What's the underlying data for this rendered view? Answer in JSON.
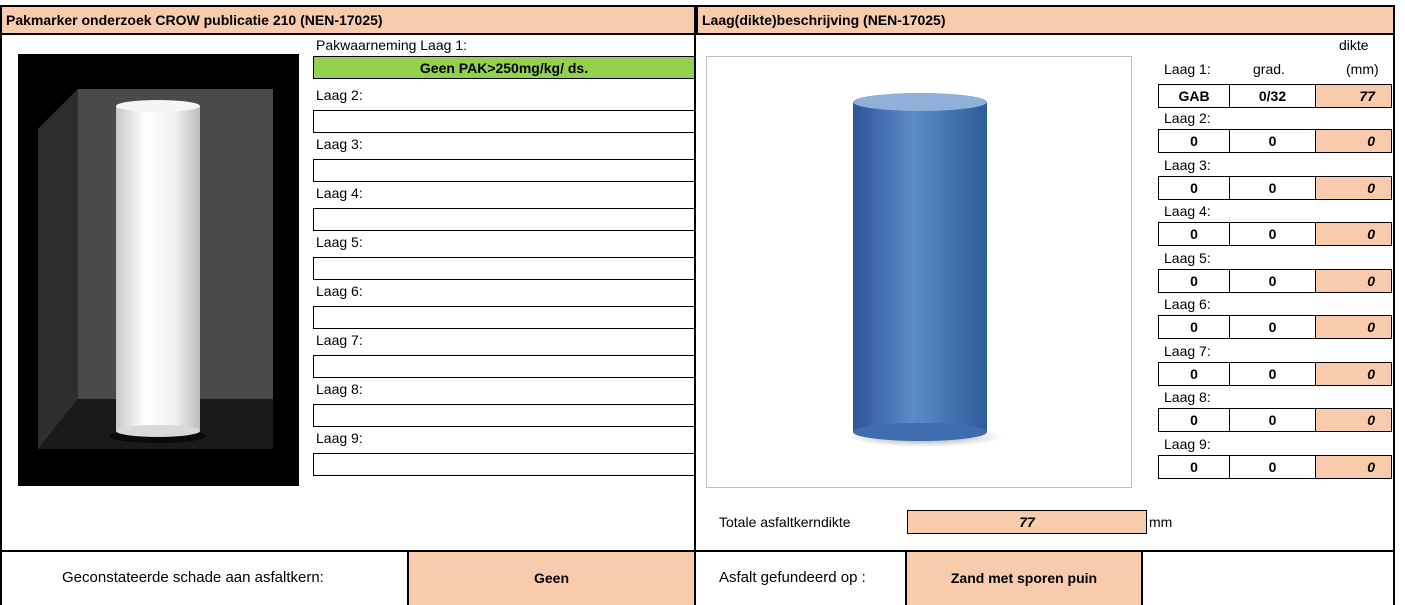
{
  "left": {
    "title": "Pakmarker onderzoek CROW publicatie 210 (NEN-17025)",
    "pak_label": "Pakwaarneming Laag 1:",
    "pak_value": "Geen PAK>250mg/kg/ ds.",
    "layer_labels": [
      "Laag 2:",
      "Laag 3:",
      "Laag 4:",
      "Laag 5:",
      "Laag 6:",
      "Laag 7:",
      "Laag 8:",
      "Laag 9:"
    ],
    "damage_label": "Geconstateerde schade aan asfaltkern:",
    "damage_value": "Geen"
  },
  "right": {
    "title": "Laag(dikte)beschrijving (NEN-17025)",
    "col_dikte": "dikte",
    "col_grad": "grad.",
    "col_mm": "(mm)",
    "layers": [
      {
        "label": "Laag 1:",
        "type": "GAB",
        "grad": "0/32",
        "dikte": "77"
      },
      {
        "label": "Laag 2:",
        "type": "0",
        "grad": "0",
        "dikte": "0"
      },
      {
        "label": "Laag 3:",
        "type": "0",
        "grad": "0",
        "dikte": "0"
      },
      {
        "label": "Laag 4:",
        "type": "0",
        "grad": "0",
        "dikte": "0"
      },
      {
        "label": "Laag 5:",
        "type": "0",
        "grad": "0",
        "dikte": "0"
      },
      {
        "label": "Laag 6:",
        "type": "0",
        "grad": "0",
        "dikte": "0"
      },
      {
        "label": "Laag 7:",
        "type": "0",
        "grad": "0",
        "dikte": "0"
      },
      {
        "label": "Laag 8:",
        "type": "0",
        "grad": "0",
        "dikte": "0"
      },
      {
        "label": "Laag 9:",
        "type": "0",
        "grad": "0",
        "dikte": "0"
      }
    ],
    "total_label": "Totale asfaltkerndikte",
    "total_value": "77",
    "total_unit": "mm",
    "foundation_label": "Asfalt gefundeerd op :",
    "foundation_value": "Zand met sporen puin"
  },
  "colors": {
    "header_orange": "#f8cbad",
    "pak_green": "#92d050",
    "core_blue": "#4f81bd"
  }
}
